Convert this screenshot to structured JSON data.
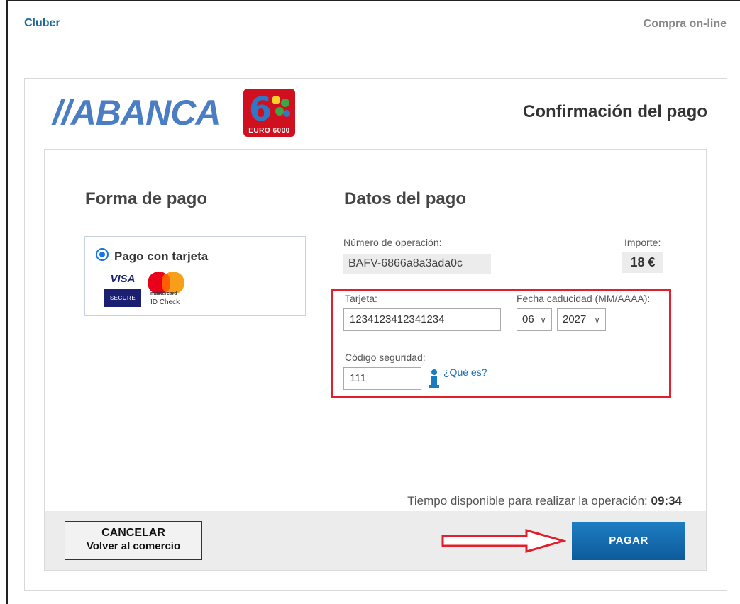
{
  "header": {
    "left_title": "Cluber",
    "right_title": "Compra on-line"
  },
  "logo": {
    "bank": "//ABANCA",
    "network": "EURO 6000"
  },
  "page_title": "Confirmación del pago",
  "forma_pago": {
    "title": "Forma de pago",
    "option_label": "Pago con tarjeta",
    "selected": true,
    "visa_text": "VISA",
    "visa_secure": "SECURE",
    "mastercard_text": "mastercard",
    "mastercard_id": "ID Check"
  },
  "datos_pago": {
    "title": "Datos del pago",
    "operacion_label": "Número de operación:",
    "operacion_value": "BAFV-6866a8a3ada0c",
    "importe_label": "Importe:",
    "importe_value": "18 €",
    "tarjeta_label": "Tarjeta:",
    "tarjeta_value": "1234123412341234",
    "fecha_label": "Fecha caducidad (MM/AAAA):",
    "mes_value": "06",
    "anio_value": "2027",
    "codigo_label": "Código seguridad:",
    "codigo_value": "111",
    "que_es_link": "¿Qué es?"
  },
  "tiempo": {
    "label": "Tiempo disponible para realizar la operación:",
    "value": "09:34"
  },
  "buttons": {
    "cancel_line1": "CANCELAR",
    "cancel_line2": "Volver al comercio",
    "pay": "PAGAR"
  },
  "colors": {
    "accent": "#1b6fb0",
    "highlight": "#e1202b",
    "pay_button": "#1470b6"
  }
}
